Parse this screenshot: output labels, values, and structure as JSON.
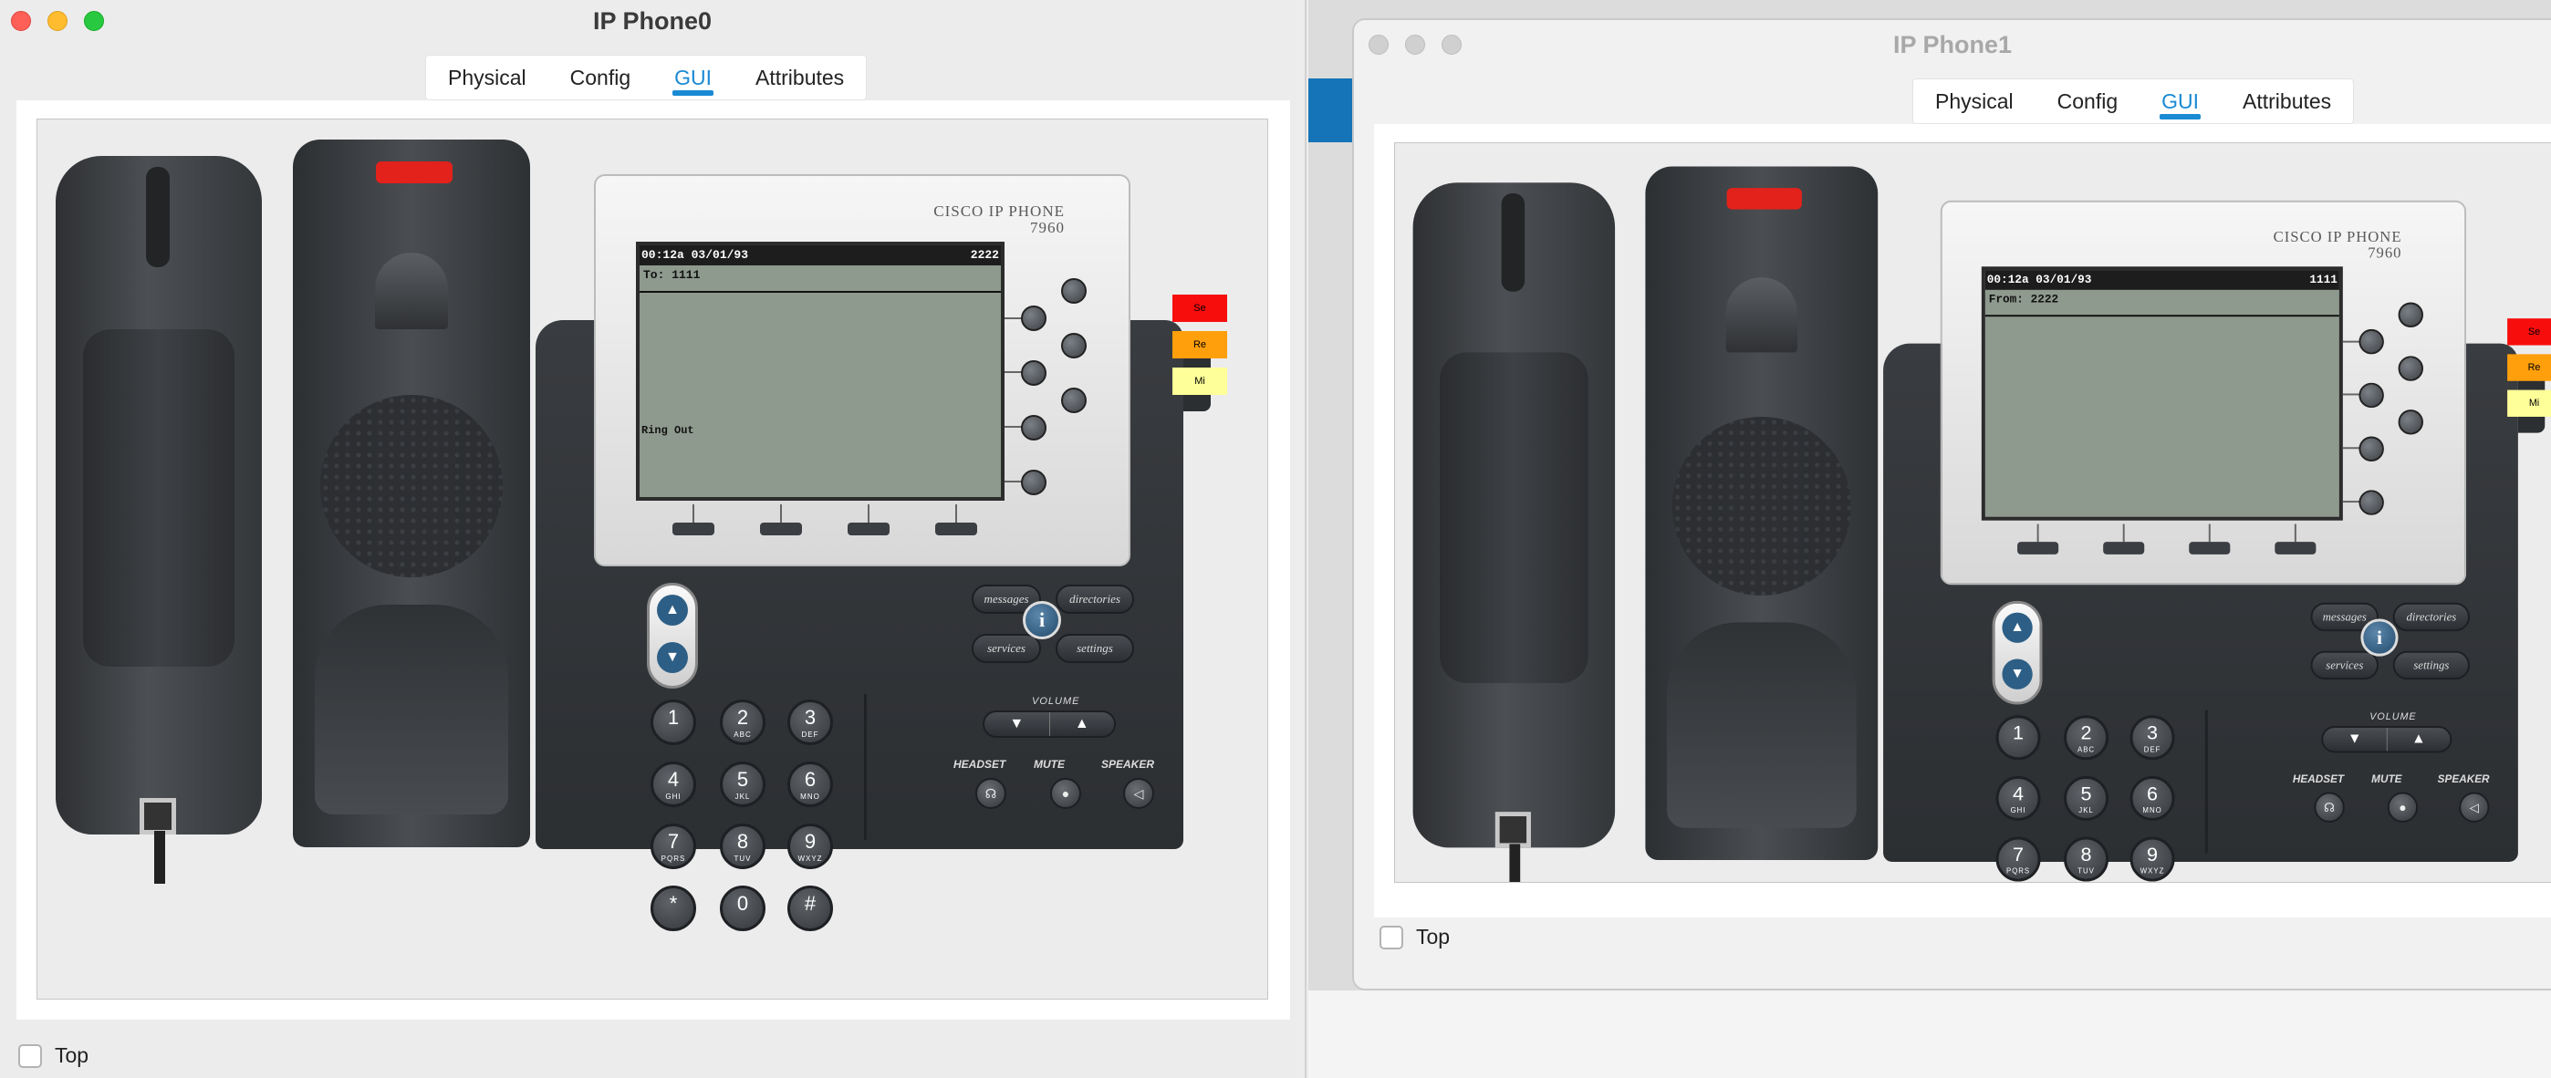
{
  "windows": [
    {
      "title": "IP Phone0",
      "tabs": [
        "Physical",
        "Config",
        "GUI",
        "Attributes"
      ],
      "active_tab": "GUI",
      "top_checkbox_label": "Top",
      "top_checked": false,
      "phone": {
        "brand_line1": "CISCO IP PHONE",
        "brand_line2": "7960",
        "lcd_time": "00:12a 03/01/93",
        "lcd_number": "2222",
        "lcd_line": "To: 1111",
        "lcd_status": "Ring Out",
        "line_buttons": [
          "Se",
          "Re",
          "Mi"
        ]
      }
    },
    {
      "title": "IP Phone1",
      "tabs": [
        "Physical",
        "Config",
        "GUI",
        "Attributes"
      ],
      "active_tab": "GUI",
      "top_checkbox_label": "Top",
      "top_checked": false,
      "phone": {
        "brand_line1": "CISCO IP PHONE",
        "brand_line2": "7960",
        "lcd_time": "00:12a 03/01/93",
        "lcd_number": "1111",
        "lcd_line": "From: 2222",
        "lcd_status": "",
        "line_buttons": [
          "Se",
          "Re",
          "Mi"
        ]
      }
    }
  ],
  "keypad": [
    {
      "d": "1",
      "s": ""
    },
    {
      "d": "2",
      "s": "ABC"
    },
    {
      "d": "3",
      "s": "DEF"
    },
    {
      "d": "4",
      "s": "GHI"
    },
    {
      "d": "5",
      "s": "JKL"
    },
    {
      "d": "6",
      "s": "MNO"
    },
    {
      "d": "7",
      "s": "PQRS"
    },
    {
      "d": "8",
      "s": "TUV"
    },
    {
      "d": "9",
      "s": "WXYZ"
    },
    {
      "d": "*",
      "s": ""
    },
    {
      "d": "0",
      "s": ""
    },
    {
      "d": "#",
      "s": ""
    }
  ],
  "function_keys": {
    "messages": "messages",
    "directories": "directories",
    "services": "services",
    "settings": "settings",
    "info": "i"
  },
  "volume_label": "VOLUME",
  "headset_label": "HEADSET",
  "mute_label": "MUTE",
  "speaker_label": "SPEAKER",
  "colors": {
    "line1": "#f80d0d",
    "line2": "#ff9f0c",
    "line3": "#ffff99",
    "tab_active": "#1a8ad4"
  }
}
